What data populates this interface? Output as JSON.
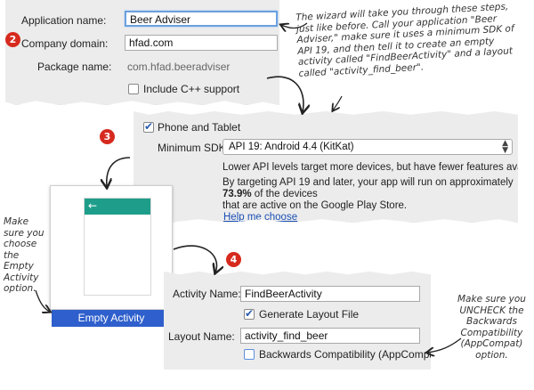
{
  "steps": {
    "two": "2",
    "three": "3",
    "four": "4"
  },
  "project": {
    "app_name_label": "Application name:",
    "app_name_value": "Beer Adviser",
    "domain_label": "Company domain:",
    "domain_value": "hfad.com",
    "package_label": "Package name:",
    "package_value": "com.hfad.beeradviser",
    "cpp_label": "Include C++ support"
  },
  "sdk": {
    "phone_label": "Phone and Tablet",
    "min_sdk_label": "Minimum SDK",
    "min_sdk_value": "API 19: Android 4.4 (KitKat)",
    "info_line1": "Lower API levels target more devices, but have fewer features available.",
    "info_line2": "By targeting API 19 and later, your app will run on approximately",
    "info_percent": "73.9%",
    "info_line3_rest": " of the devices",
    "info_line4": "that are active on the Google Play Store.",
    "help_link": "Help me choose"
  },
  "template": {
    "back_glyph": "←",
    "empty_activity": "Empty Activity"
  },
  "activity": {
    "name_label": "Activity Name:",
    "name_value": "FindBeerActivity",
    "generate_label": "Generate Layout File",
    "layout_label": "Layout Name:",
    "layout_value": "activity_find_beer",
    "backwards_label": "Backwards Compatibility (AppCompat)"
  },
  "notes": {
    "wizard": [
      "The wizard will take you through these steps,",
      "just like before. Call your application \"Beer",
      "Adviser,\" make sure it uses a minimum SDK of",
      "API 19, and then tell it to create an empty",
      "activity called \"FindBeerActivity\" and a layout",
      "called \"activity_find_beer\"."
    ],
    "empty": [
      "Make",
      "sure you",
      "choose",
      "the",
      "Empty",
      "Activity",
      "option."
    ],
    "uncheck": [
      "Make sure you",
      "UNCHECK the",
      "Backwards",
      "Compatibility",
      "(AppCompat)",
      "option."
    ]
  },
  "colors": {
    "badge": "#d62a1e",
    "teal": "#1e9e8a",
    "selected": "#2e5fcc",
    "link": "#1a4fb5"
  }
}
